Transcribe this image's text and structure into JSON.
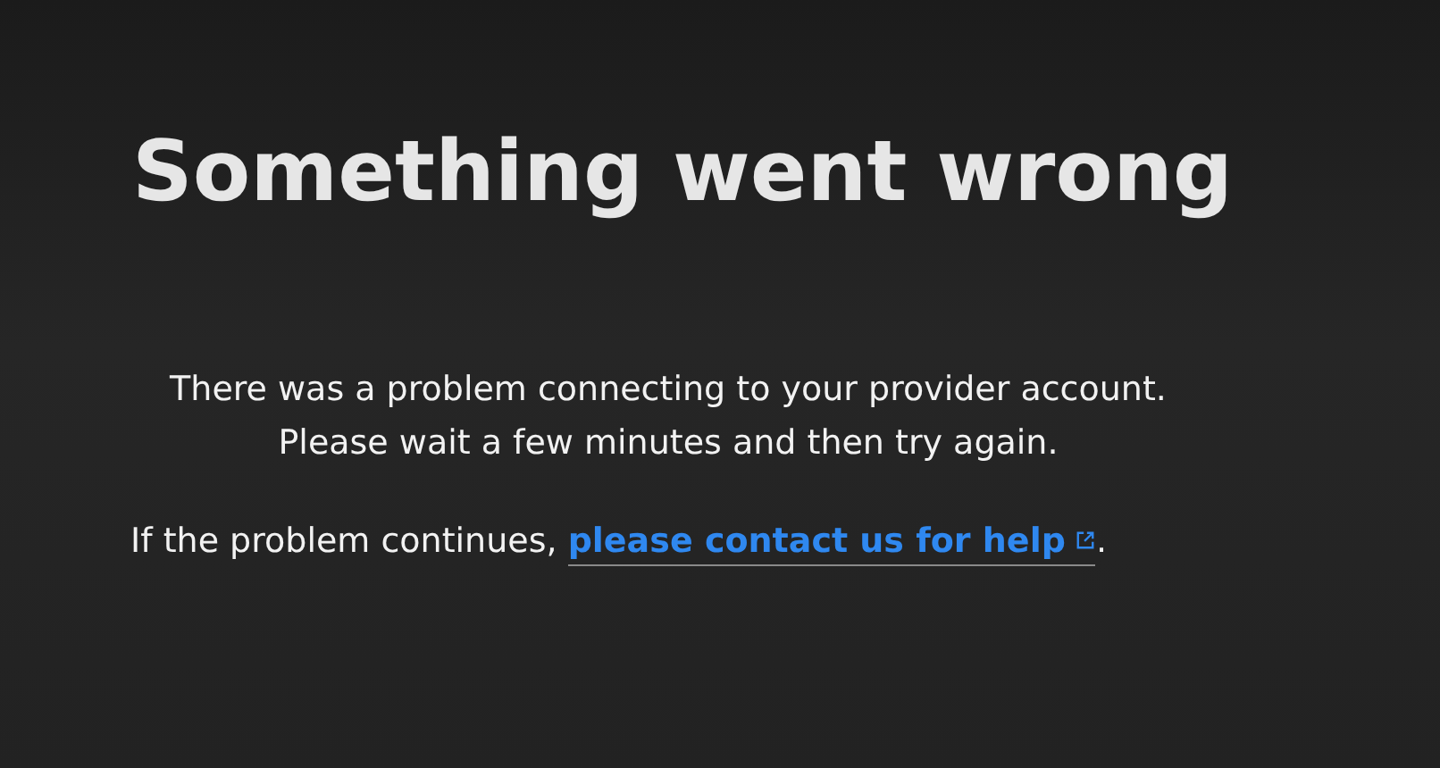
{
  "title": "Something went wrong",
  "message": "There was a problem connecting to your provider account. Please wait a few minutes and then try again.",
  "help": {
    "prefix": "If the problem continues, ",
    "link": "please contact us for help",
    "suffix": "."
  }
}
